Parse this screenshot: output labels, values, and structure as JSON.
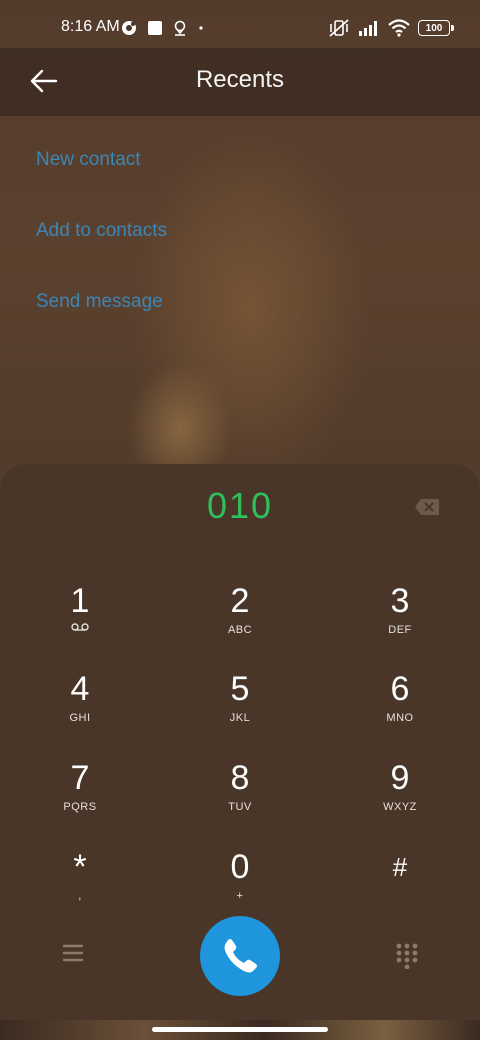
{
  "status_bar": {
    "time": "8:16 AM",
    "battery": "100",
    "icons_left": [
      "ubuntu-icon",
      "square-icon",
      "location-pin-icon",
      "dot-icon"
    ],
    "icons_right": [
      "vibrate-muted-icon",
      "signal-icon",
      "wifi-icon",
      "battery-icon"
    ]
  },
  "header": {
    "title": "Recents",
    "back_icon": "arrow-left-icon"
  },
  "actions": {
    "new_contact": "New contact",
    "add_to_contacts": "Add to contacts",
    "send_message": "Send message"
  },
  "dialer": {
    "number": "010",
    "backspace_icon": "backspace-icon",
    "keys": [
      {
        "digit": "1",
        "letters": "",
        "icon": "voicemail-icon"
      },
      {
        "digit": "2",
        "letters": "ABC"
      },
      {
        "digit": "3",
        "letters": "DEF"
      },
      {
        "digit": "4",
        "letters": "GHI"
      },
      {
        "digit": "5",
        "letters": "JKL"
      },
      {
        "digit": "6",
        "letters": "MNO"
      },
      {
        "digit": "7",
        "letters": "PQRS"
      },
      {
        "digit": "8",
        "letters": "TUV"
      },
      {
        "digit": "9",
        "letters": "WXYZ"
      },
      {
        "digit": "*",
        "letters": ","
      },
      {
        "digit": "0",
        "letters": "+"
      },
      {
        "digit": "#",
        "letters": ""
      }
    ]
  },
  "bottom_bar": {
    "menu_icon": "menu-icon",
    "call_icon": "phone-icon",
    "keypad_icon": "dialpad-icon"
  },
  "colors": {
    "number": "#2fbf5b",
    "link": "#3c86b6",
    "call_button": "#1e95dc"
  }
}
